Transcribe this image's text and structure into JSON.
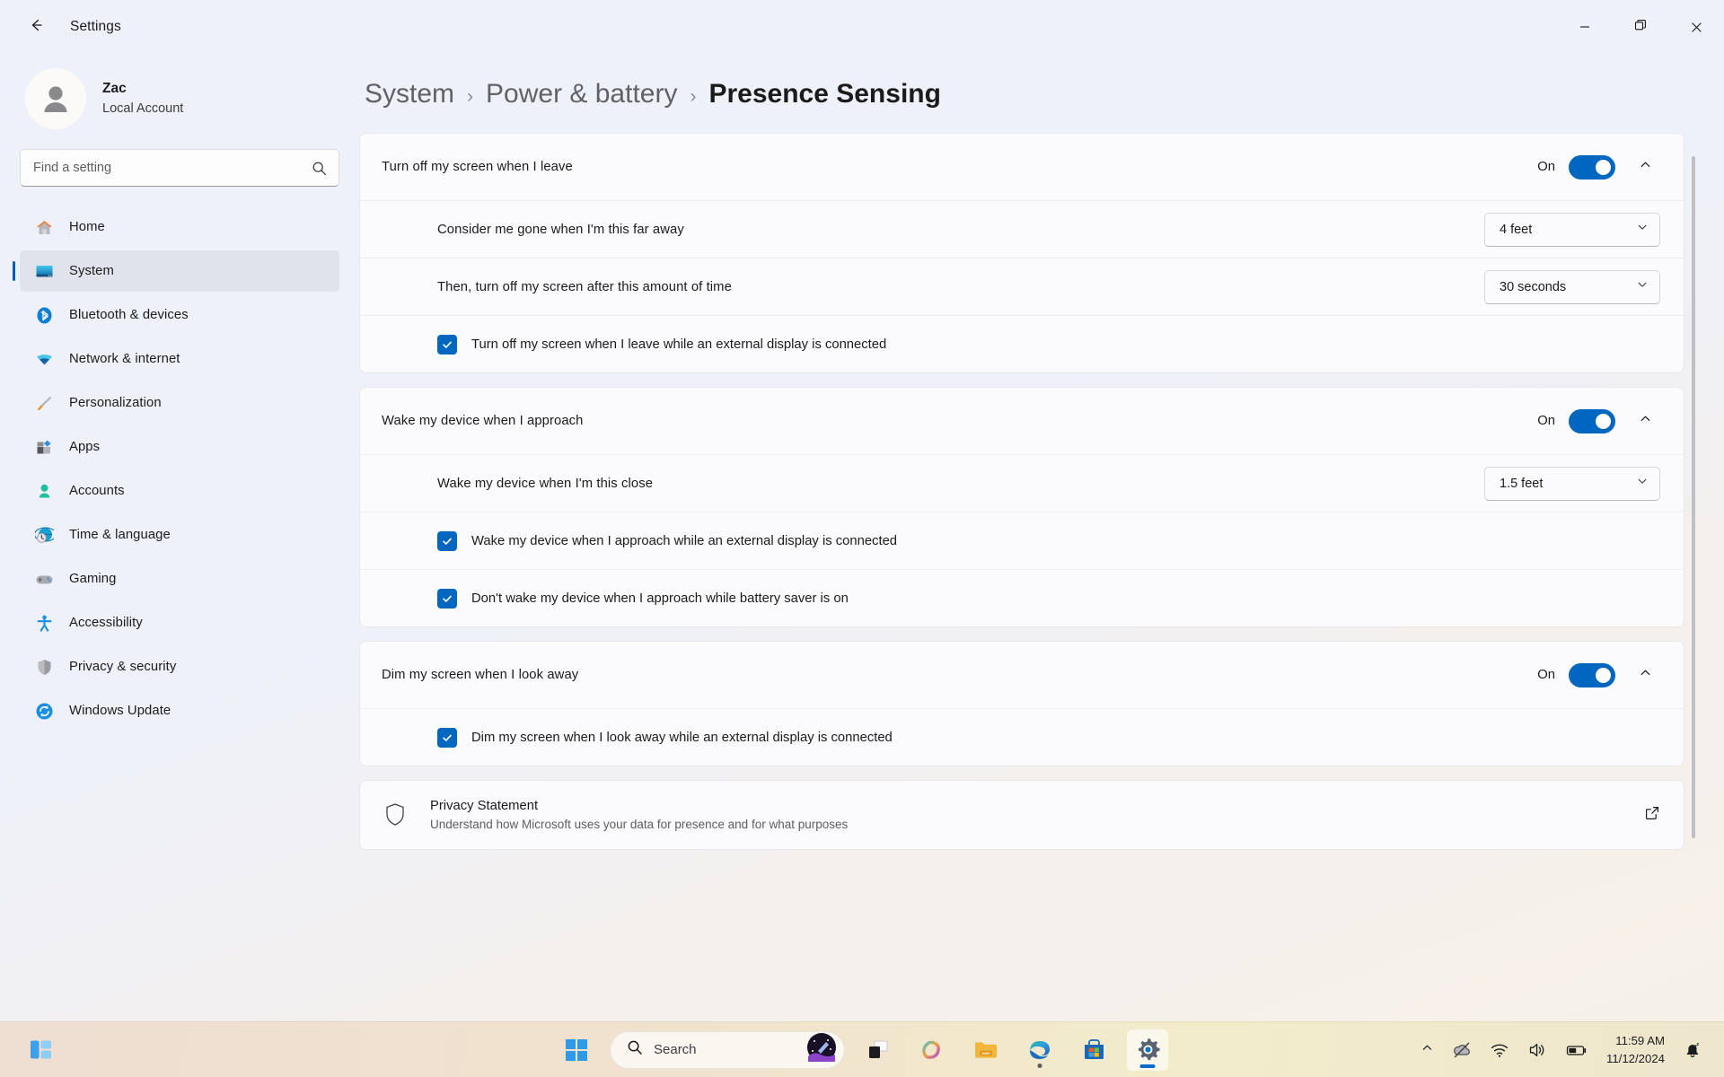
{
  "window": {
    "title": "Settings",
    "back_icon": "arrow-left-icon",
    "minimize_label": "Minimize",
    "maximize_label": "Restore",
    "close_label": "Close"
  },
  "account": {
    "name": "Zac",
    "type": "Local Account",
    "avatar_icon": "person-avatar-icon"
  },
  "search": {
    "placeholder": "Find a setting",
    "value": "",
    "icon": "search-icon"
  },
  "sidebar": {
    "items": [
      {
        "label": "Home",
        "icon": "home-icon",
        "active": false
      },
      {
        "label": "System",
        "icon": "system-monitor-icon",
        "active": true
      },
      {
        "label": "Bluetooth & devices",
        "icon": "bluetooth-icon",
        "active": false
      },
      {
        "label": "Network & internet",
        "icon": "wifi-icon",
        "active": false
      },
      {
        "label": "Personalization",
        "icon": "paintbrush-icon",
        "active": false
      },
      {
        "label": "Apps",
        "icon": "apps-icon",
        "active": false
      },
      {
        "label": "Accounts",
        "icon": "accounts-person-icon",
        "active": false
      },
      {
        "label": "Time & language",
        "icon": "clock-globe-icon",
        "active": false
      },
      {
        "label": "Gaming",
        "icon": "gamepad-icon",
        "active": false
      },
      {
        "label": "Accessibility",
        "icon": "accessibility-person-icon",
        "active": false
      },
      {
        "label": "Privacy & security",
        "icon": "shield-icon",
        "active": false
      },
      {
        "label": "Windows Update",
        "icon": "update-refresh-icon",
        "active": false
      }
    ]
  },
  "breadcrumb": {
    "items": [
      "System",
      "Power & battery",
      "Presence Sensing"
    ],
    "separator": "›"
  },
  "groups": [
    {
      "title": "Turn off my screen when I leave",
      "state": "On",
      "expanded": true,
      "rows": [
        {
          "kind": "combo",
          "label": "Consider me gone when I'm this far away",
          "value": "4 feet"
        },
        {
          "kind": "combo",
          "label": "Then, turn off my screen after this amount of time",
          "value": "30 seconds"
        },
        {
          "kind": "checkbox",
          "label": "Turn off my screen when I leave while an external display is connected",
          "checked": true
        }
      ]
    },
    {
      "title": "Wake my device when I approach",
      "state": "On",
      "expanded": true,
      "rows": [
        {
          "kind": "combo",
          "label": "Wake my device when I'm this close",
          "value": "1.5 feet"
        },
        {
          "kind": "checkbox",
          "label": "Wake my device when I approach while an external display is connected",
          "checked": true
        },
        {
          "kind": "checkbox",
          "label": "Don't wake my device when I approach while battery saver is on",
          "checked": true
        }
      ]
    },
    {
      "title": "Dim my screen when I look away",
      "state": "On",
      "expanded": true,
      "rows": [
        {
          "kind": "checkbox",
          "label": "Dim my screen when I look away while an external display is connected",
          "checked": true
        }
      ]
    }
  ],
  "privacy": {
    "title": "Privacy Statement",
    "subtitle": "Understand how Microsoft uses your data for presence and for what purposes",
    "icon": "shield-icon",
    "external_icon": "open-external-icon"
  },
  "taskbar": {
    "widgets_icon": "widgets-icon",
    "start_icon": "windows-start-icon",
    "search_placeholder": "Search",
    "search_icon": "search-icon",
    "apps": [
      {
        "name": "task-view-icon",
        "running": false,
        "active": false
      },
      {
        "name": "copilot-icon",
        "running": false,
        "active": false
      },
      {
        "name": "file-explorer-icon",
        "running": false,
        "active": false
      },
      {
        "name": "edge-browser-icon",
        "running": true,
        "active": false
      },
      {
        "name": "microsoft-store-icon",
        "running": false,
        "active": false
      },
      {
        "name": "settings-gear-icon",
        "running": true,
        "active": true
      }
    ],
    "tray": {
      "chevron_icon": "chevron-up-icon",
      "onedrive_icon": "onedrive-offline-icon",
      "wifi_icon": "wifi-icon",
      "volume_icon": "volume-icon",
      "battery_icon": "battery-icon",
      "notification_icon": "bell-dnd-icon"
    },
    "time": "11:59 AM",
    "date": "11/12/2024"
  },
  "colors": {
    "accent": "#0067c0",
    "accent_dark": "#005fb8",
    "card_bg": "#fbfbfd"
  }
}
